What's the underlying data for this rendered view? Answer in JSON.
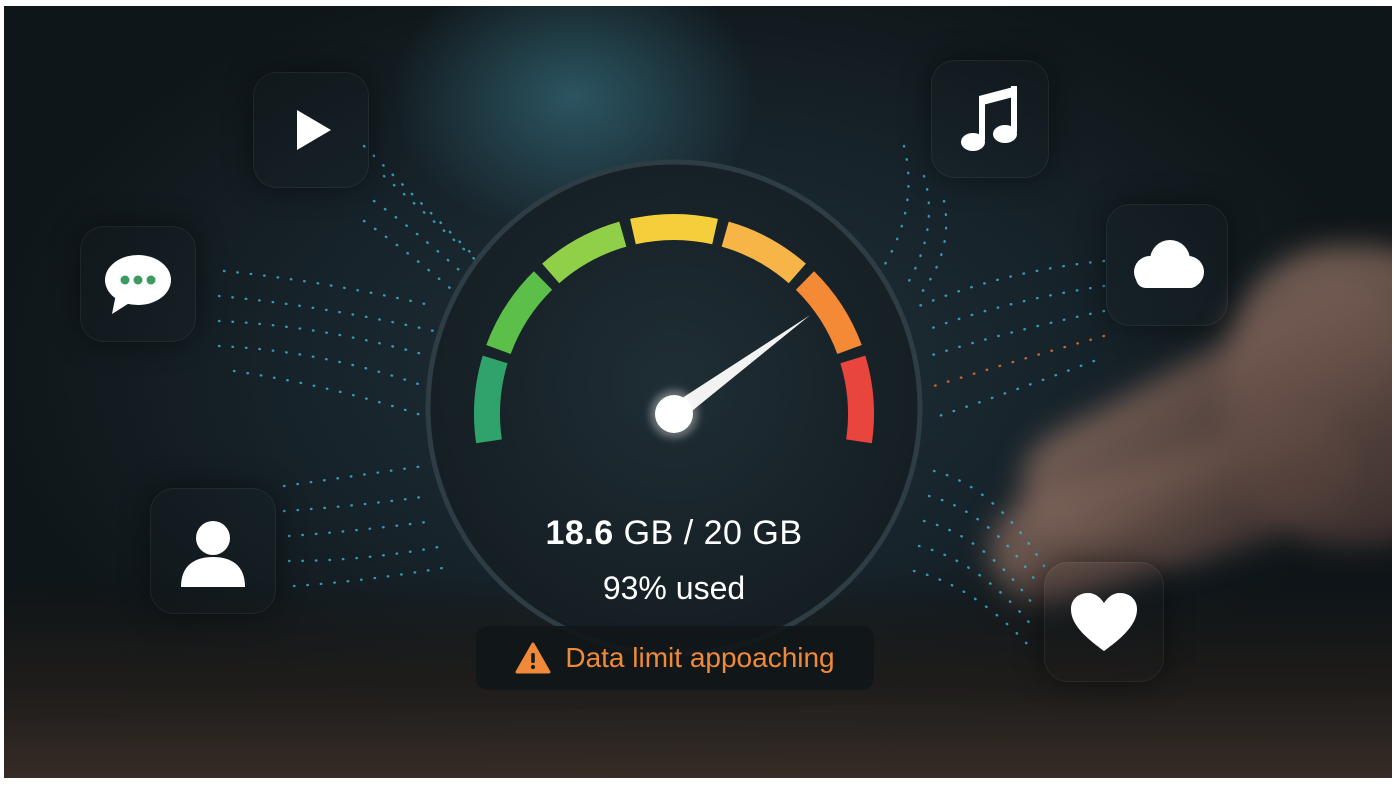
{
  "usage": {
    "used": "18.6",
    "used_unit": "GB",
    "separator": "/",
    "limit": "20 GB",
    "percent_text": "93% used",
    "fraction": 0.93
  },
  "warning": {
    "text": "Data limit appoaching",
    "icon": "warning-triangle-icon",
    "color": "#f08a3a"
  },
  "gauge": {
    "segment_colors": [
      "#2fa36b",
      "#5cbf4a",
      "#8fd048",
      "#f4cf3b",
      "#f7b548",
      "#f58a36",
      "#e8463c"
    ]
  },
  "apps": [
    {
      "name": "video",
      "icon": "play-icon",
      "color": "#d93c30"
    },
    {
      "name": "messages",
      "icon": "chat-bubble-icon",
      "color": "#3c9a63"
    },
    {
      "name": "contacts",
      "icon": "user-icon",
      "color": "#2f6fb8"
    },
    {
      "name": "music",
      "icon": "music-note-icon",
      "color": "#5a4fb0"
    },
    {
      "name": "cloud",
      "icon": "cloud-icon",
      "color": "#2f72c8"
    },
    {
      "name": "favorites",
      "icon": "heart-icon",
      "color": "#d84a5f"
    }
  ]
}
